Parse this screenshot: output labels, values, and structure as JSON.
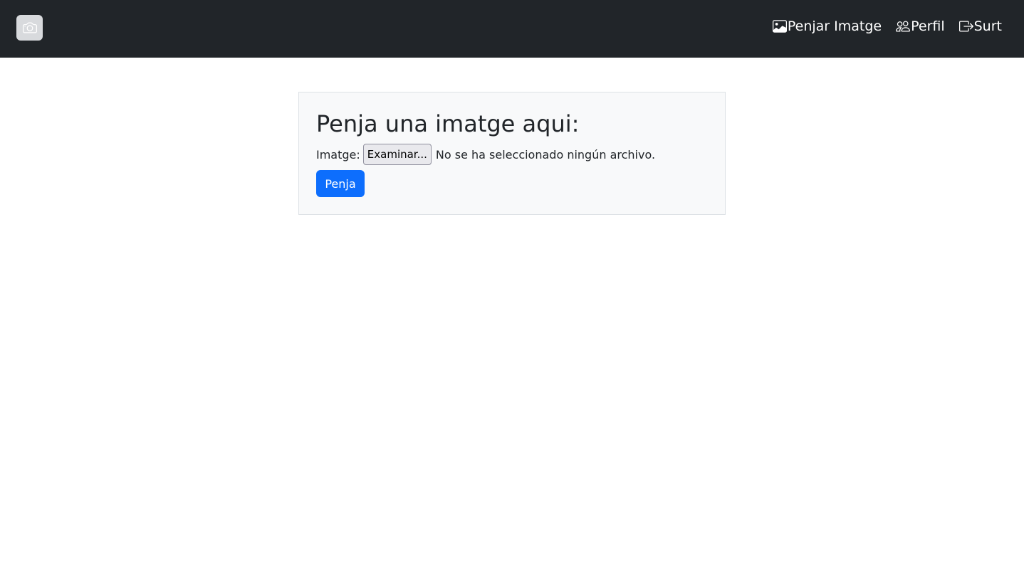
{
  "navbar": {
    "brand_icon": "camera-icon",
    "links": [
      {
        "label": "Penjar Imatge",
        "icon": "image-icon"
      },
      {
        "label": "Perfil",
        "icon": "people-icon"
      },
      {
        "label": "Surt",
        "icon": "box-arrow-right-icon"
      }
    ],
    "background_color": "#212529"
  },
  "upload_card": {
    "title": "Penja una imatge aqui:",
    "file_label": "Imatge:",
    "browse_label": "Examinar...",
    "file_status": "No se ha seleccionado ningún archivo.",
    "submit_label": "Penja",
    "submit_color": "#0d6efd"
  }
}
